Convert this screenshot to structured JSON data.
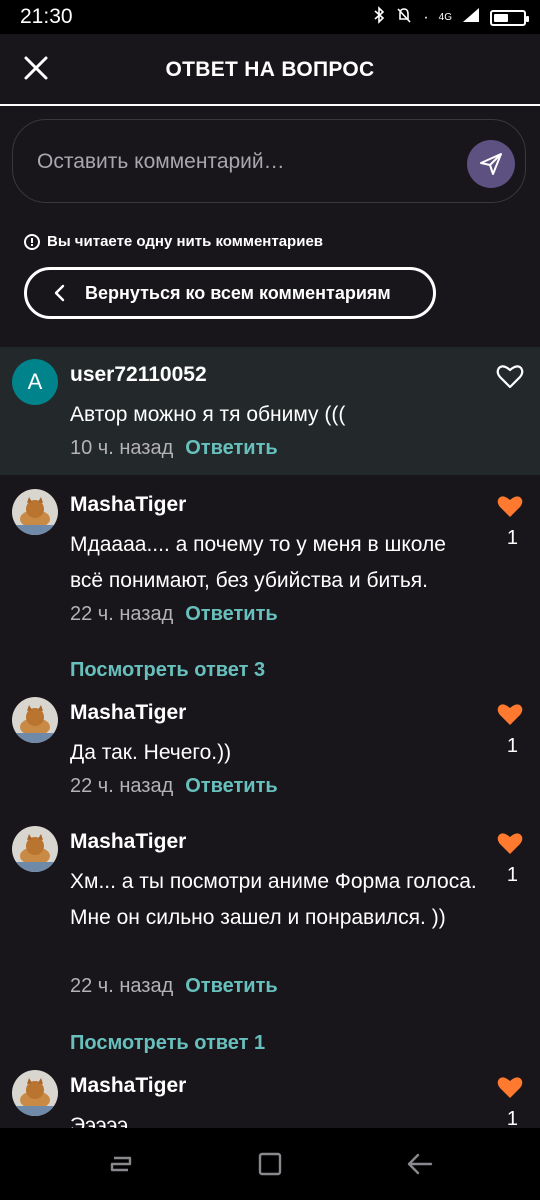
{
  "status_bar": {
    "time": "21:30",
    "network": "4G"
  },
  "header": {
    "title": "ОТВЕТ НА ВОПРОС"
  },
  "comment_input": {
    "placeholder": "Оставить комментарий…"
  },
  "thread_note": "Вы читаете одну нить комментариев",
  "back_button": {
    "label": "Вернуться ко всем комментариям"
  },
  "comments": [
    {
      "avatar_letter": "A",
      "user": "user72110052",
      "text": "Автор можно я тя обниму (((",
      "time": "10 ч. назад",
      "reply": "Ответить"
    },
    {
      "user": "MashaTiger",
      "text": "Мдаааа.... а почему то у меня в школе всё понимают, без убийства и битья.",
      "time": "22 ч. назад",
      "reply": "Ответить",
      "likes": "1"
    },
    {
      "user": "MashaTiger",
      "text": "Да так. Нечего.))",
      "time": "22 ч. назад",
      "reply": "Ответить",
      "likes": "1"
    },
    {
      "user": "MashaTiger",
      "text": "Хм... а ты посмотри аниме Форма голоса. Мне он сильно зашел и понравился. ))",
      "time": "22 ч. назад",
      "reply": "Ответить",
      "likes": "1"
    },
    {
      "user": "MashaTiger",
      "text": "Эээээ",
      "likes": "1"
    }
  ],
  "view_replies": [
    "Посмотреть ответ 3",
    "Посмотреть ответ 1"
  ],
  "colors": {
    "background": "#19161b",
    "accent": "#67c0bd",
    "like": "#ff7a2f",
    "send": "#5c5181",
    "highlight": "#23282a"
  }
}
